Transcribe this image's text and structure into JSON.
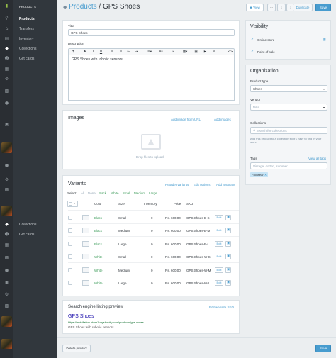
{
  "nav": {
    "section_title": "PRODUCTS",
    "items": [
      {
        "label": "Products"
      },
      {
        "label": "Transfers"
      },
      {
        "label": "Inventory"
      },
      {
        "label": "Collections"
      },
      {
        "label": "Gift cards"
      }
    ],
    "lower_items": [
      {
        "label": "Collections"
      },
      {
        "label": "Gift cards"
      }
    ]
  },
  "header": {
    "breadcrumb": "Products",
    "separator": "/",
    "title": "GPS Shoes",
    "view_label": "View",
    "duplicate_label": "Duplicate",
    "save_label": "Save"
  },
  "details": {
    "title_label": "Title",
    "title_value": "GPS Shoes",
    "description_label": "Description",
    "description_text": "GPS Shoes with robotic sensors"
  },
  "images": {
    "heading": "Images",
    "add_url_label": "Add image from URL",
    "add_images_label": "Add images",
    "drop_text": "Drop files to upload"
  },
  "variants": {
    "heading": "Variants",
    "reorder_label": "Reorder variants",
    "edit_options_label": "Edit options",
    "add_variant_label": "Add a variant",
    "select_label": "Select:",
    "filters": [
      "All",
      "None",
      "Black",
      "White",
      "Small",
      "Medium",
      "Large"
    ],
    "columns": [
      "Color",
      "Size",
      "Inventory",
      "Price",
      "SKU"
    ],
    "edit_label": "Edit",
    "rows": [
      {
        "color": "Black",
        "size": "Small",
        "inventory": "0",
        "price": "Rs. 600.00",
        "sku": "GPS Shoes-B-S"
      },
      {
        "color": "Black",
        "size": "Medium",
        "inventory": "0",
        "price": "Rs. 600.00",
        "sku": "GPS Shoes-B-M"
      },
      {
        "color": "Black",
        "size": "Large",
        "inventory": "0",
        "price": "Rs. 600.00",
        "sku": "GPS Shoes-B-L"
      },
      {
        "color": "White",
        "size": "Small",
        "inventory": "0",
        "price": "Rs. 600.00",
        "sku": "GPS Shoes-W-S"
      },
      {
        "color": "White",
        "size": "Medium",
        "inventory": "0",
        "price": "Rs. 600.00",
        "sku": "GPS Shoes-W-M"
      },
      {
        "color": "White",
        "size": "Large",
        "inventory": "0",
        "price": "Rs. 600.00",
        "sku": "GPS Shoes-W-L"
      }
    ]
  },
  "seo": {
    "heading": "Search engine listing preview",
    "edit_label": "Edit website SEO",
    "preview_title": "GPS Shoes",
    "preview_url": "https://installation-store1.myshopify.com/products/gps-shoes",
    "preview_description": "GPS Shoes with robotic sensors"
  },
  "visibility": {
    "heading": "Visibility",
    "channels": [
      {
        "label": "Online store"
      },
      {
        "label": "Point of sale"
      }
    ]
  },
  "organization": {
    "heading": "Organization",
    "product_type_label": "Product type",
    "product_type_value": "Shoes",
    "vendor_label": "Vendor",
    "vendor_placeholder": "Nike",
    "collections_label": "Collections",
    "collections_placeholder": "Search for collections",
    "collections_help": "Add this product to a collection so it's easy to find in your store.",
    "tags_label": "Tags",
    "view_all_tags_label": "View all tags",
    "tags_placeholder": "Vintage, cotton, summer",
    "tags": [
      "Footwear"
    ]
  },
  "footer": {
    "delete_label": "Delete product",
    "save_label": "Save"
  },
  "colors": {
    "accent": "#479ccf",
    "green_text": "#3d9c5a",
    "sidebar_dark": "#2a2e33",
    "sidebar_panel": "#31373d"
  }
}
